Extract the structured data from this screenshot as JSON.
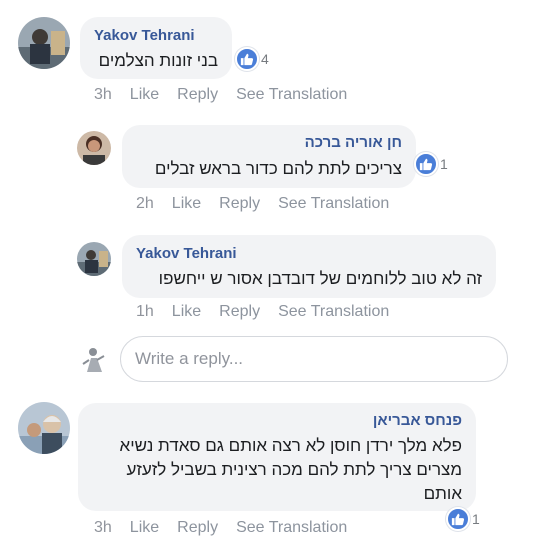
{
  "comments": [
    {
      "author": "Yakov Tehrani",
      "text": "בני זונות הצלמים",
      "reaction_count": "4",
      "time": "3h",
      "like": "Like",
      "reply": "Reply",
      "translate": "See Translation"
    },
    {
      "author": "חן אוריה ברכה",
      "text": "צריכים לתת להם כדור בראש זבלים",
      "reaction_count": "1",
      "time": "2h",
      "like": "Like",
      "reply": "Reply",
      "translate": "See Translation"
    },
    {
      "author": "Yakov Tehrani",
      "text": "זה לא טוב ללוחמים של דובדבן אסור ש ייחשפו",
      "time": "1h",
      "like": "Like",
      "reply": "Reply",
      "translate": "See Translation"
    },
    {
      "author": "פנחס אבריאן",
      "lines": [
        "פלא מלך ירדן חוסן לא רצה  אותם גם סאדת נשיא",
        "מצרים  צריך לתת להם מכה  רצינית בשביל לזעזע",
        "אותם"
      ],
      "reaction_count": "1",
      "time": "3h",
      "like": "Like",
      "reply": "Reply",
      "translate": "See Translation"
    }
  ],
  "reply_box": {
    "placeholder": "Write a reply..."
  },
  "colors": {
    "author": "#385898",
    "bubble": "#f2f3f5",
    "like_badge": "#4a7ed8",
    "meta": "#90949c"
  },
  "icons": {
    "reaction": "thumbs-up-icon"
  }
}
